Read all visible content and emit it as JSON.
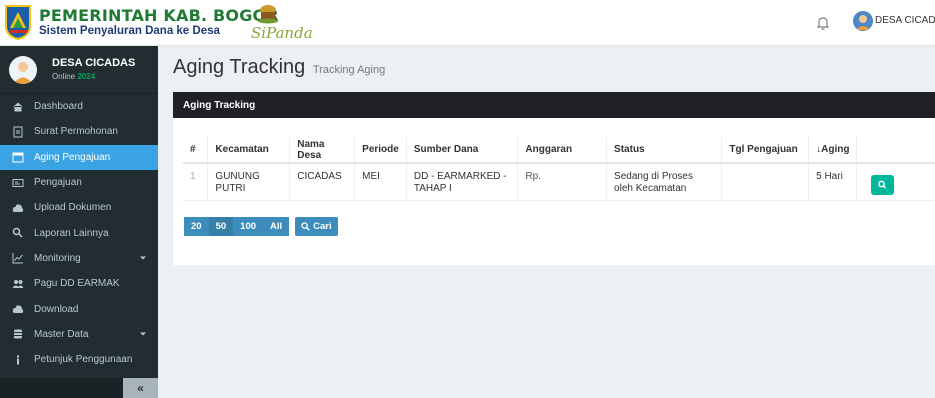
{
  "header": {
    "title": "PEMERINTAH KAB. BOGOR",
    "subtitle": "Sistem Penyaluran Dana ke Desa",
    "app_logo_text": "SiPanda",
    "user_name": "DESA CICADAS"
  },
  "sidebar": {
    "profile_name": "DESA CICADAS",
    "profile_status": "Online",
    "profile_year": "2024",
    "items": [
      {
        "label": "Dashboard",
        "icon": "home-icon"
      },
      {
        "label": "Surat Permohonan",
        "icon": "file-icon"
      },
      {
        "label": "Aging Pengajuan",
        "icon": "calendar-icon",
        "active": true
      },
      {
        "label": "Pengajuan",
        "icon": "card-icon"
      },
      {
        "label": "Upload Dokumen",
        "icon": "cloud-upload-icon"
      },
      {
        "label": "Laporan Lainnya",
        "icon": "search-icon"
      },
      {
        "label": "Monitoring",
        "icon": "line-chart-icon",
        "has_submenu": true
      },
      {
        "label": "Pagu DD EARMAK",
        "icon": "users-icon"
      },
      {
        "label": "Download",
        "icon": "cloud-download-icon"
      },
      {
        "label": "Master Data",
        "icon": "database-icon",
        "has_submenu": true
      },
      {
        "label": "Petunjuk Penggunaan",
        "icon": "info-icon"
      }
    ],
    "collapse_label": "«"
  },
  "page": {
    "title": "Aging Tracking",
    "subtitle": "Tracking Aging"
  },
  "box": {
    "title": "Aging Tracking",
    "columns": [
      "#",
      "Kecamatan",
      "Nama Desa",
      "Periode",
      "Sumber Dana",
      "Anggaran",
      "Status",
      "Tgl Pengajuan",
      "↓Aging",
      ""
    ],
    "rows": [
      {
        "no": "1",
        "kecamatan": "GUNUNG PUTRI",
        "nama_desa": "CICADAS",
        "periode": "MEI",
        "sumber_dana": "DD - EARMARKED - TAHAP I",
        "anggaran": "Rp.",
        "status": "Sedang di Proses oleh Kecamatan",
        "tgl_pengajuan": "",
        "aging": "5 Hari"
      }
    ],
    "pagination": [
      "20",
      "50",
      "100",
      "All"
    ],
    "active_page_size": "50",
    "search_button": "Cari"
  },
  "colors": {
    "sidebar_bg": "#222d32",
    "active_item": "#3aa3e3",
    "box_header": "#202124",
    "action_button": "#00b79c",
    "pager": "#3c8dbc"
  }
}
